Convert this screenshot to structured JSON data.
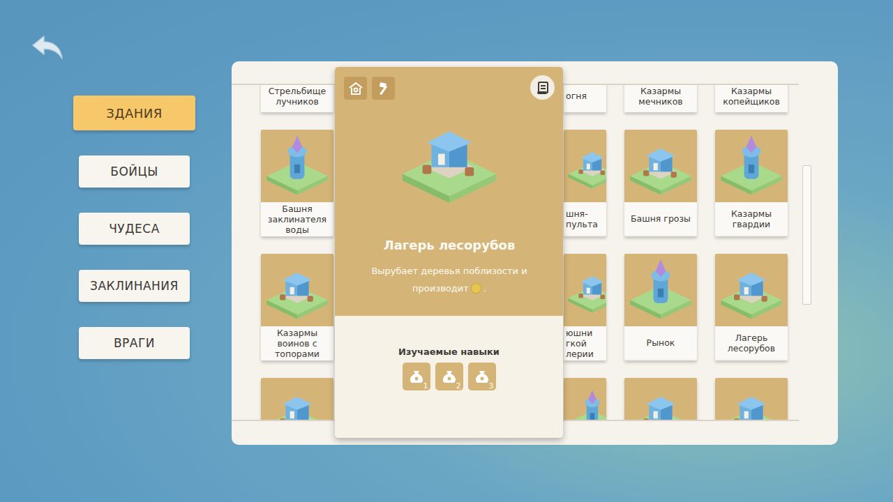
{
  "sidebar": {
    "items": [
      {
        "label": "ЗДАНИЯ",
        "selected": true
      },
      {
        "label": "БОЙЦЫ",
        "selected": false
      },
      {
        "label": "ЧУДЕСА",
        "selected": false
      },
      {
        "label": "ЗАКЛИНАНИЯ",
        "selected": false
      },
      {
        "label": "ВРАГИ",
        "selected": false
      }
    ]
  },
  "grid": {
    "rows": [
      {
        "cards": [
          {
            "label": "Стрельбище лучников",
            "kind": "full"
          },
          {
            "label": "огня",
            "kind": "partial"
          },
          {
            "label": "Казармы мечников",
            "kind": "full"
          },
          {
            "label": "Казармы копейщиков",
            "kind": "full"
          }
        ]
      },
      {
        "cards": [
          {
            "label": "Башня заклинателя воды",
            "kind": "full"
          },
          {
            "label": "шня-\nпульта",
            "kind": "partial"
          },
          {
            "label": "Башня грозы",
            "kind": "full"
          },
          {
            "label": "Казармы гвардии",
            "kind": "full"
          }
        ]
      },
      {
        "cards": [
          {
            "label": "Казармы воинов с топорами",
            "kind": "full"
          },
          {
            "label": "юшни\nгкой\nлерии",
            "kind": "partial"
          },
          {
            "label": "Рынок",
            "kind": "full"
          },
          {
            "label": "Лагерь лесорубов",
            "kind": "full"
          }
        ]
      },
      {
        "cards": [
          {
            "kind": "full"
          },
          {
            "kind": "partial"
          },
          {
            "kind": "full"
          },
          {
            "kind": "full"
          }
        ]
      }
    ]
  },
  "popup": {
    "title": "Лагерь лесорубов",
    "description_start": "Вырубает деревья поблизости и производит",
    "description_end": ".",
    "skills_title": "Изучаемые навыки",
    "skills": [
      {
        "number": "1"
      },
      {
        "number": "2"
      },
      {
        "number": "3"
      }
    ]
  }
}
